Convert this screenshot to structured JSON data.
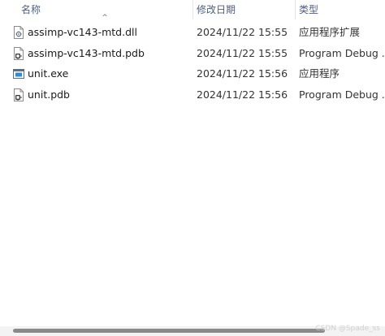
{
  "header": {
    "name_label": "名称",
    "date_label": "修改日期",
    "type_label": "类型",
    "sort_caret": "^"
  },
  "files": [
    {
      "name": "assimp-vc143-mtd.dll",
      "date": "2024/11/22 15:55",
      "type": "应用程序扩展",
      "icon": "dll-file-icon"
    },
    {
      "name": "assimp-vc143-mtd.pdb",
      "date": "2024/11/22 15:55",
      "type": "Program Debug ...",
      "icon": "pdb-file-icon"
    },
    {
      "name": "unit.exe",
      "date": "2024/11/22 15:56",
      "type": "应用程序",
      "icon": "exe-file-icon"
    },
    {
      "name": "unit.pdb",
      "date": "2024/11/22 15:56",
      "type": "Program Debug ...",
      "icon": "pdb-file-icon"
    }
  ],
  "watermark": "CSDN @Spade_ss"
}
